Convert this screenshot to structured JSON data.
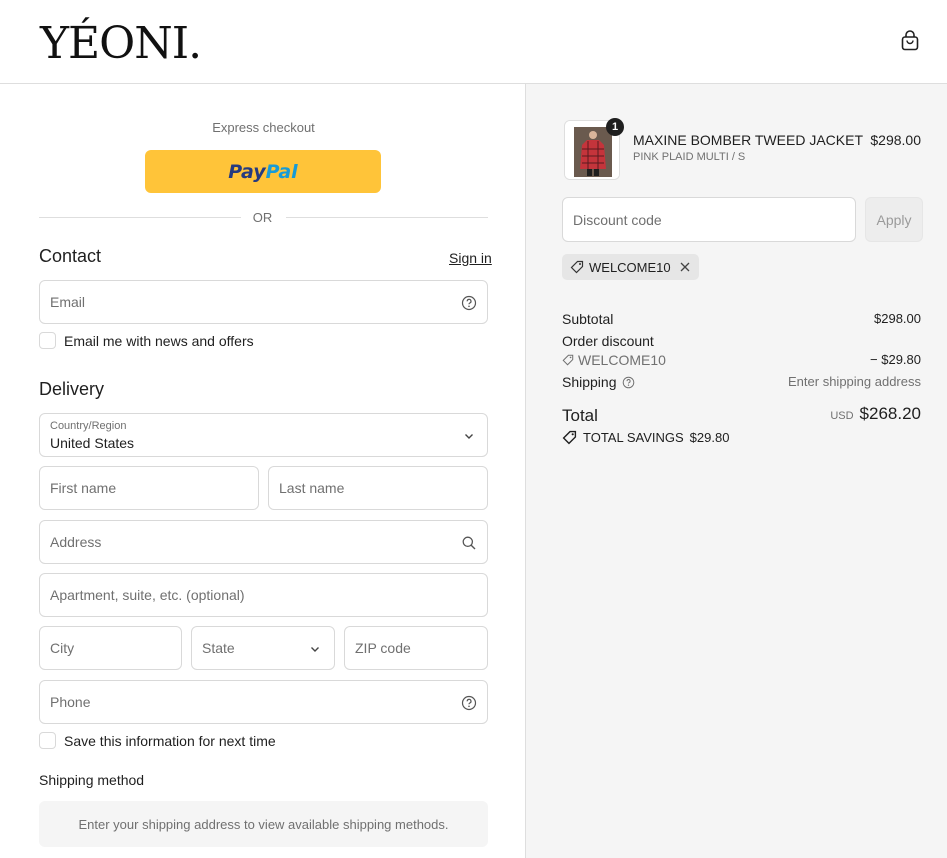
{
  "header": {
    "logo_text": "YÉONI."
  },
  "express": {
    "title": "Express checkout",
    "paypal_part1": "Pay",
    "paypal_part2": "Pal",
    "or": "OR"
  },
  "contact": {
    "title": "Contact",
    "sign_in": "Sign in",
    "email_placeholder": "Email",
    "newsletter_label": "Email me with news and offers"
  },
  "delivery": {
    "title": "Delivery",
    "country_label": "Country/Region",
    "country_value": "United States",
    "first_name": "First name",
    "last_name": "Last name",
    "address": "Address",
    "apartment": "Apartment, suite, etc. (optional)",
    "city": "City",
    "state": "State",
    "zip": "ZIP code",
    "phone": "Phone",
    "save_info_label": "Save this information for next time"
  },
  "shipping_method": {
    "title": "Shipping method",
    "message": "Enter your shipping address to view available shipping methods."
  },
  "cart": {
    "item": {
      "quantity": "1",
      "name": "MAXINE BOMBER TWEED JACKET",
      "variant": "PINK PLAID MULTI / S",
      "price": "$298.00"
    },
    "discount_placeholder": "Discount code",
    "apply_label": "Apply",
    "applied_code": "WELCOME10",
    "subtotal_label": "Subtotal",
    "subtotal_value": "$298.00",
    "order_discount_label": "Order discount",
    "order_discount_code": "WELCOME10",
    "order_discount_value": "− $29.80",
    "shipping_label": "Shipping",
    "shipping_value": "Enter shipping address",
    "total_label": "Total",
    "total_currency": "USD",
    "total_value": "$268.20",
    "savings_label": "TOTAL SAVINGS",
    "savings_value": "$29.80"
  },
  "colors": {
    "paypal_yellow": "#ffc439",
    "paypal_dark_blue": "#253b80",
    "paypal_light_blue": "#179bd7",
    "summary_bg": "#f5f5f5"
  }
}
